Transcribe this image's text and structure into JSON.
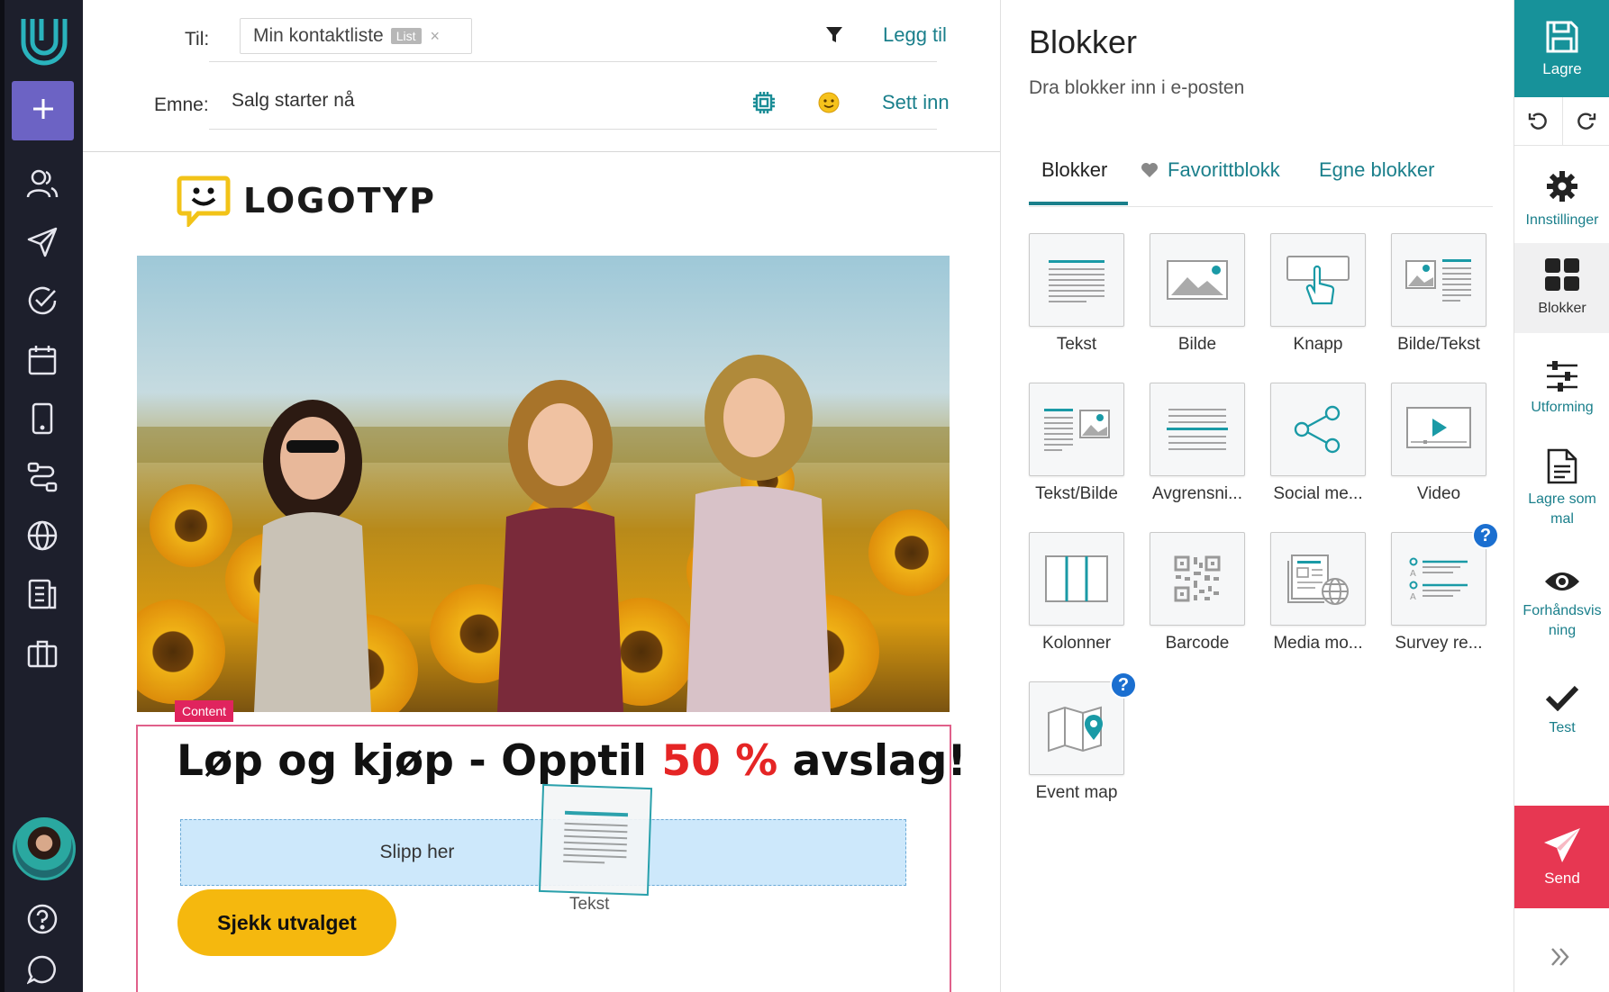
{
  "nav": {
    "icons": [
      "app-logo",
      "plus-icon",
      "contacts-icon",
      "send-icon",
      "check-circle-icon",
      "calendar-icon",
      "mobile-icon",
      "workflow-icon",
      "globe-icon",
      "reports-icon",
      "briefcase-icon",
      "avatar",
      "help-icon",
      "chat-icon"
    ],
    "accent": "#6c63c4"
  },
  "header": {
    "to_label": "Til:",
    "recipient": "Min kontaktliste",
    "recipient_tag": "List",
    "recipient_remove": "×",
    "add_label": "Legg til",
    "subject_label": "Emne:",
    "subject_value": "Salg starter nå",
    "insert_label": "Sett inn"
  },
  "email": {
    "logo_text": "LOGOTYP",
    "content_tag": "Content",
    "headline_before": "Løp og kjøp - Opptil ",
    "headline_highlight": "50 %",
    "headline_after": " avslag!",
    "drop_text": "Slipp her",
    "button_label": "Sjekk utvalget",
    "drag_ghost_label": "Tekst"
  },
  "panel": {
    "title": "Blokker",
    "subtitle": "Dra blokker inn i e-posten",
    "tabs": [
      "Blokker",
      "Favorittblokk",
      "Egne blokker"
    ],
    "blocks": [
      {
        "label": "Tekst",
        "icon": "text-block-icon"
      },
      {
        "label": "Bilde",
        "icon": "image-block-icon"
      },
      {
        "label": "Knapp",
        "icon": "button-block-icon"
      },
      {
        "label": "Bilde/Tekst",
        "icon": "image-text-block-icon"
      },
      {
        "label": "Tekst/Bilde",
        "icon": "text-image-block-icon"
      },
      {
        "label": "Avgrensni...",
        "icon": "divider-block-icon"
      },
      {
        "label": "Social me...",
        "icon": "social-block-icon"
      },
      {
        "label": "Video",
        "icon": "video-block-icon"
      },
      {
        "label": "Kolonner",
        "icon": "columns-block-icon"
      },
      {
        "label": "Barcode",
        "icon": "barcode-block-icon"
      },
      {
        "label": "Media mo...",
        "icon": "media-block-icon"
      },
      {
        "label": "Survey re...",
        "icon": "survey-block-icon"
      },
      {
        "label": "Event map",
        "icon": "map-block-icon"
      }
    ],
    "help_badge": "?"
  },
  "toolbar": {
    "save": "Lagre",
    "settings": "Innstillinger",
    "blocks": "Blokker",
    "design": "Utforming",
    "save_template": "Lagre som mal",
    "preview": "Forhåndsvis ning",
    "test": "Test",
    "send": "Send",
    "colors": {
      "save": "#17929a",
      "send": "#e73752",
      "link": "#1a7f8b"
    }
  }
}
